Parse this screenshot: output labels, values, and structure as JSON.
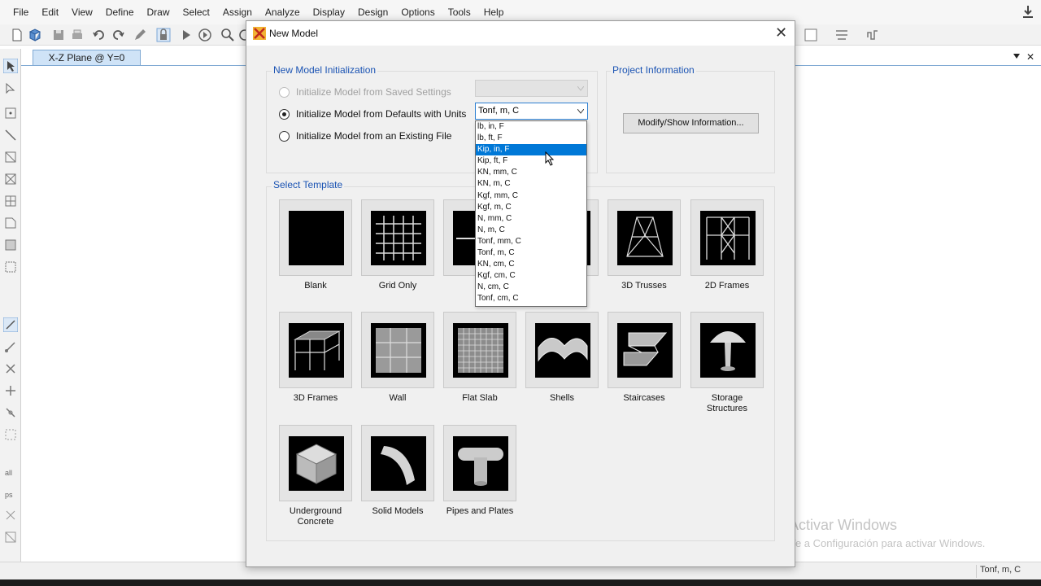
{
  "menu": [
    "File",
    "Edit",
    "View",
    "Define",
    "Draw",
    "Select",
    "Assign",
    "Analyze",
    "Display",
    "Design",
    "Options",
    "Tools",
    "Help"
  ],
  "toolbar_icons": [
    "new-model-icon",
    "open-icon",
    "save-icon",
    "print-icon",
    "undo-icon",
    "redo-icon",
    "pencil-icon",
    "lock-icon",
    "run-icon",
    "run-step-icon",
    "zoom-icon",
    "zoom-window-icon"
  ],
  "left_toolbar_icons": [
    "pointer-icon",
    "reshape-icon",
    "point-icon",
    "line-icon",
    "area-icon",
    "frame-icon",
    "grid-icon",
    "shell-icon",
    "rectangle-icon",
    "region-icon",
    "link-icon",
    "select-icon",
    "cut-icon",
    "joint-icon",
    "release-icon",
    "section-icon",
    "all-icon",
    "ps-icon",
    "clear-icon",
    "pan-icon"
  ],
  "tab": {
    "label": "X-Z Plane @ Y=0"
  },
  "status": {
    "units": "Tonf, m, C"
  },
  "watermark": {
    "title": "Activar Windows",
    "subtitle": "Ve a Configuración para activar Windows."
  },
  "dialog": {
    "title": "New Model",
    "init_group_title": "New Model Initialization",
    "project_group_title": "Project Information",
    "radio_saved": "Initialize Model from Saved Settings",
    "radio_defaults": "Initialize Model from Defaults with Units",
    "radio_existing": "Initialize Model from an Existing File",
    "units_selected": "Tonf, m, C",
    "modify_button": "Modify/Show Information...",
    "template_group_title": "Select Template",
    "templates": [
      {
        "label": "Blank",
        "icon": "blank-template-icon"
      },
      {
        "label": "Grid Only",
        "icon": "grid-only-template-icon"
      },
      {
        "label": "B",
        "icon": "beam-template-icon"
      },
      {
        "label": "",
        "icon": "hidden-template-icon"
      },
      {
        "label": "3D Trusses",
        "icon": "3d-trusses-template-icon"
      },
      {
        "label": "2D Frames",
        "icon": "2d-frames-template-icon"
      },
      {
        "label": "3D Frames",
        "icon": "3d-frames-template-icon"
      },
      {
        "label": "Wall",
        "icon": "wall-template-icon"
      },
      {
        "label": "Flat Slab",
        "icon": "flat-slab-template-icon"
      },
      {
        "label": "Shells",
        "icon": "shells-template-icon"
      },
      {
        "label": "Staircases",
        "icon": "staircases-template-icon"
      },
      {
        "label": "Storage Structures",
        "icon": "storage-structures-template-icon"
      },
      {
        "label": "Underground Concrete",
        "icon": "underground-concrete-template-icon"
      },
      {
        "label": "Solid Models",
        "icon": "solid-models-template-icon"
      },
      {
        "label": "Pipes and Plates",
        "icon": "pipes-plates-template-icon"
      }
    ]
  },
  "units_dropdown": {
    "options": [
      "lb, in, F",
      "lb, ft, F",
      "Kip, in, F",
      "Kip, ft, F",
      "KN, mm, C",
      "KN, m, C",
      "Kgf, mm, C",
      "Kgf, m, C",
      "N, mm, C",
      "N, m, C",
      "Tonf, mm, C",
      "Tonf, m, C",
      "KN, cm, C",
      "Kgf, cm, C",
      "N, cm, C",
      "Tonf, cm, C"
    ],
    "highlighted": "Kip, in, F"
  },
  "colors": {
    "highlight": "#0078d7",
    "group_title": "#1a53b3",
    "tab": "#cfe3f7"
  }
}
